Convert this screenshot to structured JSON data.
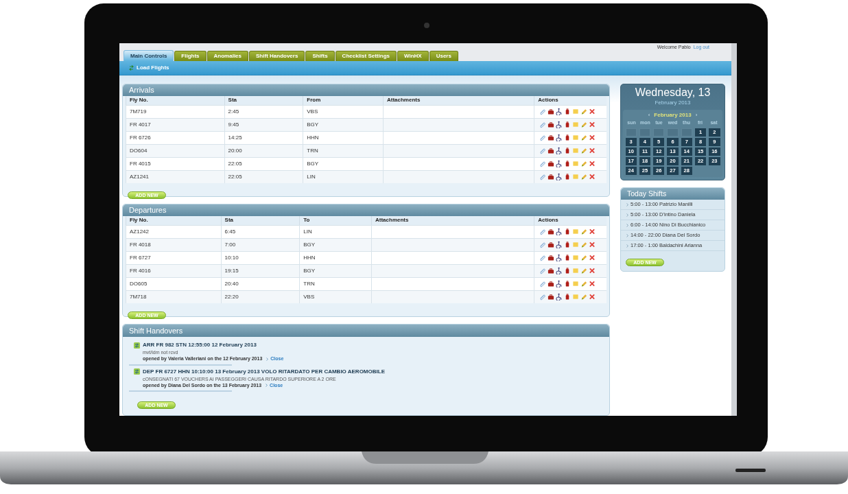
{
  "user_bar": {
    "welcome": "Welcome Pablo",
    "logout": "Log out"
  },
  "tabs": [
    {
      "label": "Main Controls",
      "selected": true
    },
    {
      "label": "Flights",
      "selected": false
    },
    {
      "label": "Anomalies",
      "selected": false
    },
    {
      "label": "Shift Handovers",
      "selected": false
    },
    {
      "label": "Shifts",
      "selected": false
    },
    {
      "label": "Checklist Settings",
      "selected": false
    },
    {
      "label": "WinHX",
      "selected": false
    },
    {
      "label": "Users",
      "selected": false
    }
  ],
  "toolbar": {
    "load_flights": "Load Flights"
  },
  "tables": [
    {
      "title": "Arrivals",
      "columns": [
        "Fly No.",
        "Sta",
        "From",
        "Attachments",
        "Actions"
      ],
      "rows": [
        {
          "fly_no": "7M719",
          "sta": "2:45",
          "airport": "VBS"
        },
        {
          "fly_no": "FR 4017",
          "sta": "9:45",
          "airport": "BGY"
        },
        {
          "fly_no": "FR 6726",
          "sta": "14:25",
          "airport": "HHN"
        },
        {
          "fly_no": "DO604",
          "sta": "20:00",
          "airport": "TRN"
        },
        {
          "fly_no": "FR 4015",
          "sta": "22:05",
          "airport": "BGY"
        },
        {
          "fly_no": "AZ1241",
          "sta": "22:05",
          "airport": "LIN"
        }
      ],
      "add_button": "ADD NEW"
    },
    {
      "title": "Departures",
      "columns": [
        "Fly No.",
        "Sta",
        "To",
        "Attachments",
        "Actions"
      ],
      "rows": [
        {
          "fly_no": "AZ1242",
          "sta": "6:45",
          "airport": "LIN"
        },
        {
          "fly_no": "FR 4018",
          "sta": "7:00",
          "airport": "BGY"
        },
        {
          "fly_no": "FR 6727",
          "sta": "10:10",
          "airport": "HHN"
        },
        {
          "fly_no": "FR 4016",
          "sta": "19:15",
          "airport": "BGY"
        },
        {
          "fly_no": "DO605",
          "sta": "20:40",
          "airport": "TRN"
        },
        {
          "fly_no": "7M718",
          "sta": "22:20",
          "airport": "VBS"
        }
      ],
      "add_button": "ADD NEW"
    }
  ],
  "shift_handovers": {
    "title": "Shift Handovers",
    "items": [
      {
        "title": "ARR FR 982 STN 12:55:00 12 February 2013",
        "note": "mvt/ldm not rcvd",
        "opened": "opened by Valeria Valleriani on the 12 February 2013",
        "action": "Close"
      },
      {
        "title": "DEP FR 6727 HHN 10:10:00 13 February 2013 VOLO RITARDATO PER CAMBIO AEROMOBILE",
        "note": "cONSEGNATI 67 VOUCHERS AI PASSEGGERI CAUSA RITARDO SUPERIORE A 2 ORE",
        "opened": "opened by Diana Del Sordo on the 13 February 2013",
        "action": "Close"
      }
    ],
    "add_button": "ADD NEW"
  },
  "calendar": {
    "date_heading": "Wednesday, 13",
    "month_line": "February 2013",
    "prev": "‹",
    "month": "February 2013",
    "next": "›",
    "weekdays": [
      "sun",
      "mon",
      "tue",
      "wed",
      "thu",
      "fri",
      "sat"
    ],
    "weeks": [
      [
        {
          "kind": "blank"
        },
        {
          "kind": "blank"
        },
        {
          "kind": "blank"
        },
        {
          "kind": "blank"
        },
        {
          "kind": "blank"
        },
        {
          "kind": "day",
          "label": "1"
        },
        {
          "kind": "day",
          "label": "2"
        }
      ],
      [
        {
          "kind": "day",
          "label": "3"
        },
        {
          "kind": "day",
          "label": "4"
        },
        {
          "kind": "day",
          "label": "5"
        },
        {
          "kind": "day",
          "label": "6"
        },
        {
          "kind": "day",
          "label": "7"
        },
        {
          "kind": "day",
          "label": "8"
        },
        {
          "kind": "day",
          "label": "9"
        }
      ],
      [
        {
          "kind": "day",
          "label": "10"
        },
        {
          "kind": "day",
          "label": "11"
        },
        {
          "kind": "day",
          "label": "12"
        },
        {
          "kind": "day",
          "label": "13"
        },
        {
          "kind": "day",
          "label": "14"
        },
        {
          "kind": "day",
          "label": "15"
        },
        {
          "kind": "day",
          "label": "16"
        }
      ],
      [
        {
          "kind": "day",
          "label": "17"
        },
        {
          "kind": "day",
          "label": "18"
        },
        {
          "kind": "day",
          "label": "19"
        },
        {
          "kind": "day",
          "label": "20"
        },
        {
          "kind": "day",
          "label": "21"
        },
        {
          "kind": "day",
          "label": "22"
        },
        {
          "kind": "day",
          "label": "23"
        }
      ],
      [
        {
          "kind": "day",
          "label": "24"
        },
        {
          "kind": "day",
          "label": "25"
        },
        {
          "kind": "day",
          "label": "26"
        },
        {
          "kind": "day",
          "label": "27"
        },
        {
          "kind": "day",
          "label": "28"
        }
      ]
    ]
  },
  "today_shifts": {
    "title": "Today Shifts",
    "items": [
      "5:00 - 13:00 Patrizio Manilli",
      "5:00 - 13:00 D'intino Daniela",
      "6:00 - 14:00 Nino Di Bucchianico",
      "14:00 - 22:00 Diana Del Sordo",
      "17:00 - 1:00 Baldachini Arianna"
    ],
    "add_button": "ADD NEW"
  }
}
